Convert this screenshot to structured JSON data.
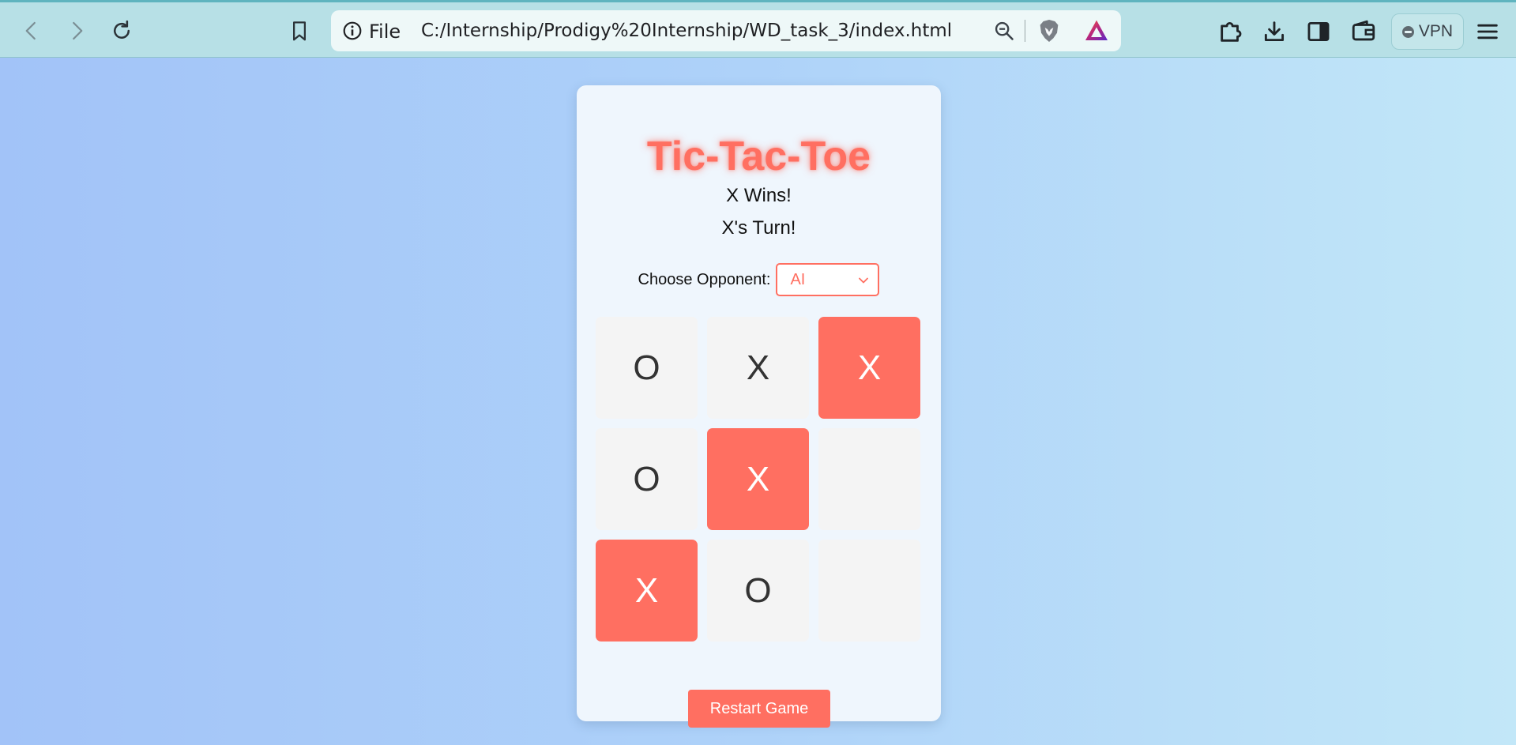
{
  "browser": {
    "address_scheme_label": "File",
    "url": "C:/Internship/Prodigy%20Internship/WD_task_3/index.html",
    "vpn_label": "VPN",
    "icons": [
      "back-icon",
      "forward-icon",
      "reload-icon",
      "bookmark-icon",
      "info-icon",
      "zoom-icon",
      "brave-shields-icon",
      "brave-rewards-icon",
      "extensions-icon",
      "download-icon",
      "sidebar-icon",
      "wallet-icon",
      "vpn-status-icon",
      "menu-icon"
    ]
  },
  "page": {
    "title": "Tic-Tac-Toe",
    "result_message": "X Wins!",
    "turn_message": "X's Turn!",
    "opponent_label": "Choose Opponent:",
    "opponent_value": "AI",
    "restart_label": "Restart Game",
    "board": [
      {
        "mark": "O",
        "winning": false
      },
      {
        "mark": "X",
        "winning": false
      },
      {
        "mark": "X",
        "winning": true
      },
      {
        "mark": "O",
        "winning": false
      },
      {
        "mark": "X",
        "winning": true
      },
      {
        "mark": "",
        "winning": false
      },
      {
        "mark": "X",
        "winning": true
      },
      {
        "mark": "O",
        "winning": false
      },
      {
        "mark": "",
        "winning": false
      }
    ]
  },
  "colors": {
    "accent": "#ff6f61",
    "card_background": "#eff6fd",
    "cell_background": "#f4f4f4",
    "browser_bar": "#b7e0e6"
  }
}
